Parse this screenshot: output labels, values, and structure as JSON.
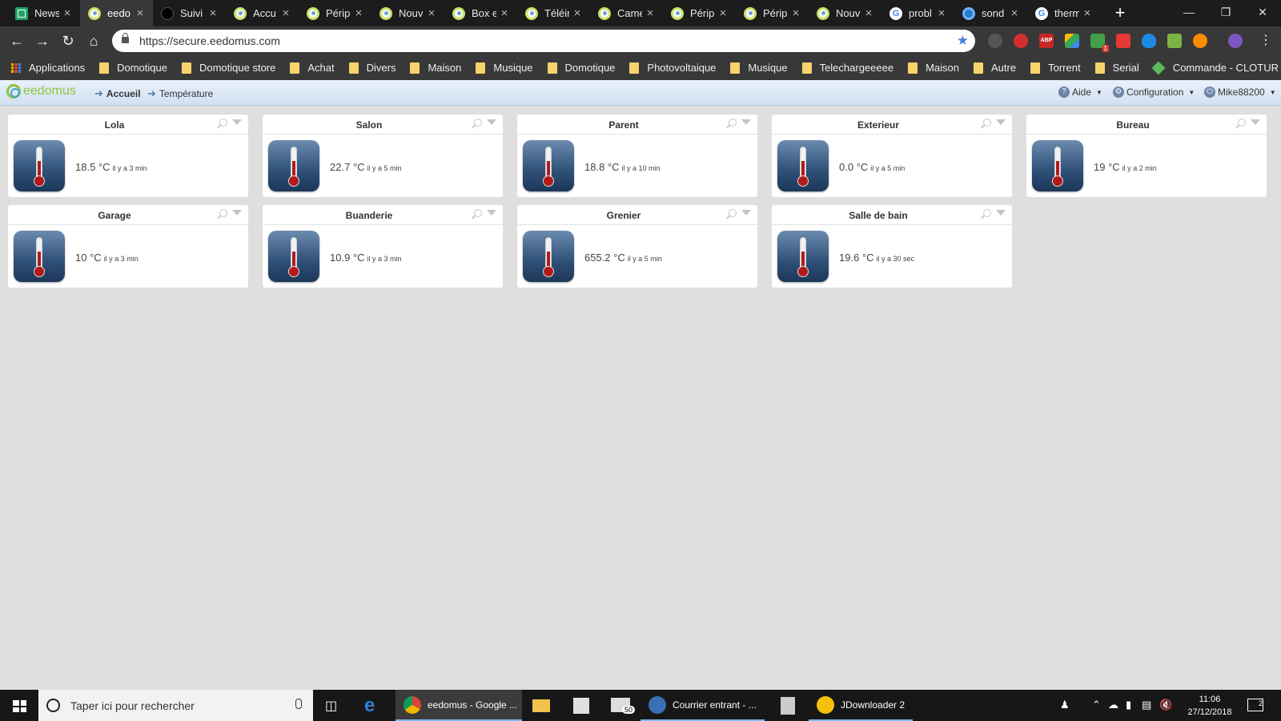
{
  "browser": {
    "tabs": [
      {
        "label": "News",
        "icon": "sheets-icon"
      },
      {
        "label": "eedo",
        "icon": "eedomus-icon",
        "active": true
      },
      {
        "label": "Suivi",
        "icon": "dark-icon"
      },
      {
        "label": "Accu",
        "icon": "eedomus-icon"
      },
      {
        "label": "Périp",
        "icon": "eedomus-icon"
      },
      {
        "label": "Nouv",
        "icon": "eedomus-icon"
      },
      {
        "label": "Box e",
        "icon": "eedomus-icon"
      },
      {
        "label": "Téléin",
        "icon": "eedomus-icon"
      },
      {
        "label": "Came",
        "icon": "eedomus-icon"
      },
      {
        "label": "Périp",
        "icon": "eedomus-icon"
      },
      {
        "label": "Périp",
        "icon": "eedomus-icon"
      },
      {
        "label": "Nouv",
        "icon": "eedomus-icon"
      },
      {
        "label": "probl",
        "icon": "google-icon"
      },
      {
        "label": "sond",
        "icon": "sond-icon"
      },
      {
        "label": "therm",
        "icon": "google-icon"
      }
    ],
    "new_tab": "+",
    "url": "https://secure.eedomus.com",
    "bookmarks": [
      {
        "label": "Applications",
        "icon": "apps-icon"
      },
      {
        "label": "Domotique",
        "icon": "folder-icon"
      },
      {
        "label": "Domotique store",
        "icon": "folder-icon"
      },
      {
        "label": "Achat",
        "icon": "folder-icon"
      },
      {
        "label": "Divers",
        "icon": "folder-icon"
      },
      {
        "label": "Maison",
        "icon": "folder-icon"
      },
      {
        "label": "Musique",
        "icon": "folder-icon"
      },
      {
        "label": "Domotique",
        "icon": "folder-icon"
      },
      {
        "label": "Photovoltaique",
        "icon": "folder-icon"
      },
      {
        "label": "Musique",
        "icon": "folder-icon"
      },
      {
        "label": "Telechargeeeee",
        "icon": "folder-icon"
      },
      {
        "label": "Maison",
        "icon": "folder-icon"
      },
      {
        "label": "Autre",
        "icon": "folder-icon"
      },
      {
        "label": "Torrent",
        "icon": "folder-icon"
      },
      {
        "label": "Serial",
        "icon": "folder-icon"
      },
      {
        "label": "Commande - CLOTUR",
        "icon": "diamond-icon"
      }
    ],
    "ext_badges": {
      "green": "1"
    }
  },
  "app": {
    "logo": "eedomus",
    "breadcrumb": {
      "home": "Accueil",
      "current": "Température"
    },
    "menu": {
      "help": "Aide",
      "config": "Configuration",
      "user": "Mike88200"
    }
  },
  "widgets": [
    {
      "title": "Lola",
      "value": "18.5",
      "unit": "°C",
      "ago": "il y a 3 min"
    },
    {
      "title": "Salon",
      "value": "22.7",
      "unit": "°C",
      "ago": "il y a 5 min"
    },
    {
      "title": "Parent",
      "value": "18.8",
      "unit": "°C",
      "ago": "il y a 10 min"
    },
    {
      "title": "Exterieur",
      "value": "0.0",
      "unit": "°C",
      "ago": "il y a 5 min"
    },
    {
      "title": "Bureau",
      "value": "19",
      "unit": "°C",
      "ago": "il y a 2 min"
    },
    {
      "title": "Garage",
      "value": "10",
      "unit": "°C",
      "ago": "il y a 3 min"
    },
    {
      "title": "Buanderie",
      "value": "10.9",
      "unit": "°C",
      "ago": "il y a 3 min"
    },
    {
      "title": "Grenier",
      "value": "655.2",
      "unit": "°C",
      "ago": "il y a 5 min"
    },
    {
      "title": "Salle de bain",
      "value": "19.6",
      "unit": "°C",
      "ago": "il y a 30 sec"
    }
  ],
  "taskbar": {
    "search_placeholder": "Taper ici pour rechercher",
    "apps": [
      {
        "label": "eedomus - Google ...",
        "icon": "chrome-icon"
      },
      {
        "label": "Courrier entrant - ...",
        "icon": "thunderbird-icon"
      },
      {
        "label": "JDownloader 2",
        "icon": "jdownloader-icon"
      }
    ],
    "mail_badge": "50",
    "time": "11:06",
    "date": "27/12/2018",
    "notif_count": "2"
  }
}
